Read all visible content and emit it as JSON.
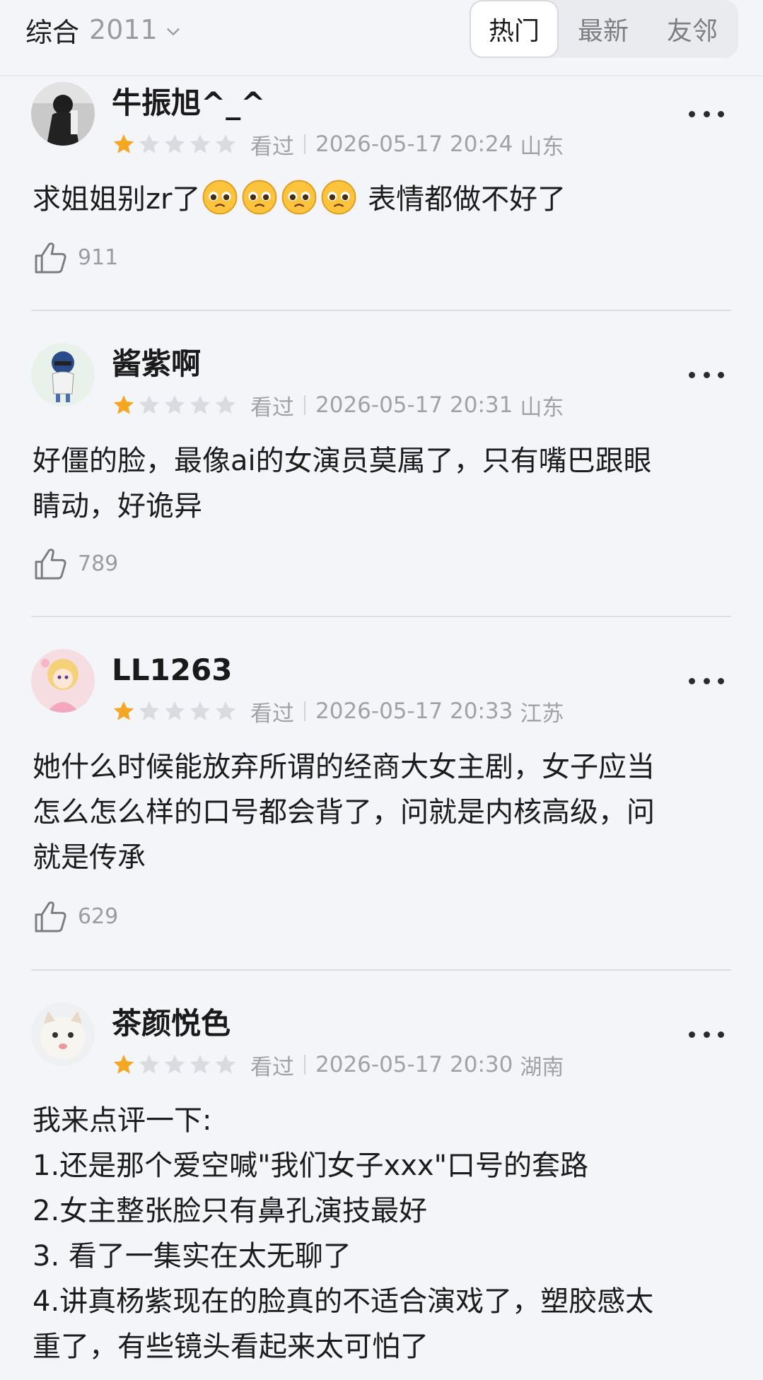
{
  "filter": {
    "label": "综合",
    "year": "2011"
  },
  "tabs": [
    {
      "label": "热门",
      "active": true
    },
    {
      "label": "最新",
      "active": false
    },
    {
      "label": "友邻",
      "active": false
    }
  ],
  "reviews": [
    {
      "user": "牛振旭^_^",
      "rating": 1,
      "status": "看过",
      "datetime": "2026-05-17 20:24",
      "location": "山东",
      "text_before": "求姐姐别zr了",
      "emoji_count": 4,
      "text_after": " 表情都做不好了",
      "likes": "911"
    },
    {
      "user": "酱紫啊",
      "rating": 1,
      "status": "看过",
      "datetime": "2026-05-17 20:31",
      "location": "山东",
      "lines": [
        "好僵的脸，最像ai的女演员莫属了，只有嘴巴跟眼",
        "睛动，好诡异"
      ],
      "likes": "789"
    },
    {
      "user": "LL1263",
      "rating": 1,
      "status": "看过",
      "datetime": "2026-05-17 20:33",
      "location": "江苏",
      "lines": [
        "她什么时候能放弃所谓的经商大女主剧，女子应当",
        "怎么怎么样的口号都会背了，问就是内核高级，问",
        "就是传承"
      ],
      "likes": "629"
    },
    {
      "user": "茶颜悦色",
      "rating": 1,
      "status": "看过",
      "datetime": "2026-05-17 20:30",
      "location": "湖南",
      "lines": [
        "我来点评一下:",
        "1.还是那个爱空喊\"我们女子xxx\"口号的套路",
        "2.女主整张脸只有鼻孔演技最好",
        "3. 看了一集实在太无聊了",
        "4.讲真杨紫现在的脸真的不适合演戏了，塑胶感太",
        "重了，有些镜头看起来太可怕了"
      ]
    }
  ],
  "colors": {
    "star_on": "#f5a623",
    "star_off": "#d9dbe0",
    "background": "#f3f5f8"
  },
  "icons": {
    "like": "thumbs-up-icon",
    "more": "more-dots-icon",
    "chevron": "chevron-down-icon"
  }
}
